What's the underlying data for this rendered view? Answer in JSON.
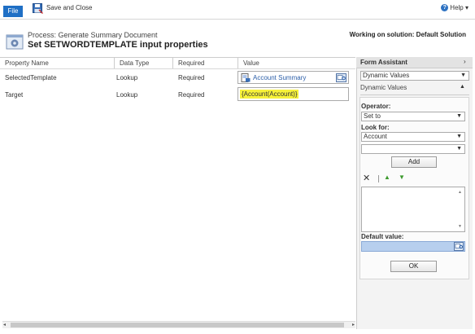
{
  "ribbon": {
    "file_label": "File",
    "save_close_label": "Save and Close",
    "help_label": "Help ▾"
  },
  "header": {
    "process_title": "Process: Generate Summary Document",
    "page_title": "Set SETWORDTEMPLATE input properties",
    "solution_text": "Working on solution: Default Solution"
  },
  "grid": {
    "columns": [
      "Property Name",
      "Data Type",
      "Required",
      "Value"
    ],
    "rows": [
      {
        "property": "SelectedTemplate",
        "type": "Lookup",
        "required": "Required",
        "value": "Account Summary"
      },
      {
        "property": "Target",
        "type": "Lookup",
        "required": "Required",
        "value": "{Account(Account)}"
      }
    ]
  },
  "assistant": {
    "title": "Form Assistant",
    "collapse_glyph": "›",
    "mode_select": "Dynamic Values",
    "section_title": "Dynamic Values",
    "operator_label": "Operator:",
    "operator_value": "Set to",
    "look_for_label": "Look for:",
    "look_for_value": "Account",
    "second_select_value": "",
    "add_label": "Add",
    "default_value_label": "Default value:",
    "ok_label": "OK"
  },
  "colors": {
    "accent": "#1f6fc5",
    "highlight": "#f7f23a",
    "link": "#2b5ea8",
    "default_field": "#b7cfee"
  }
}
